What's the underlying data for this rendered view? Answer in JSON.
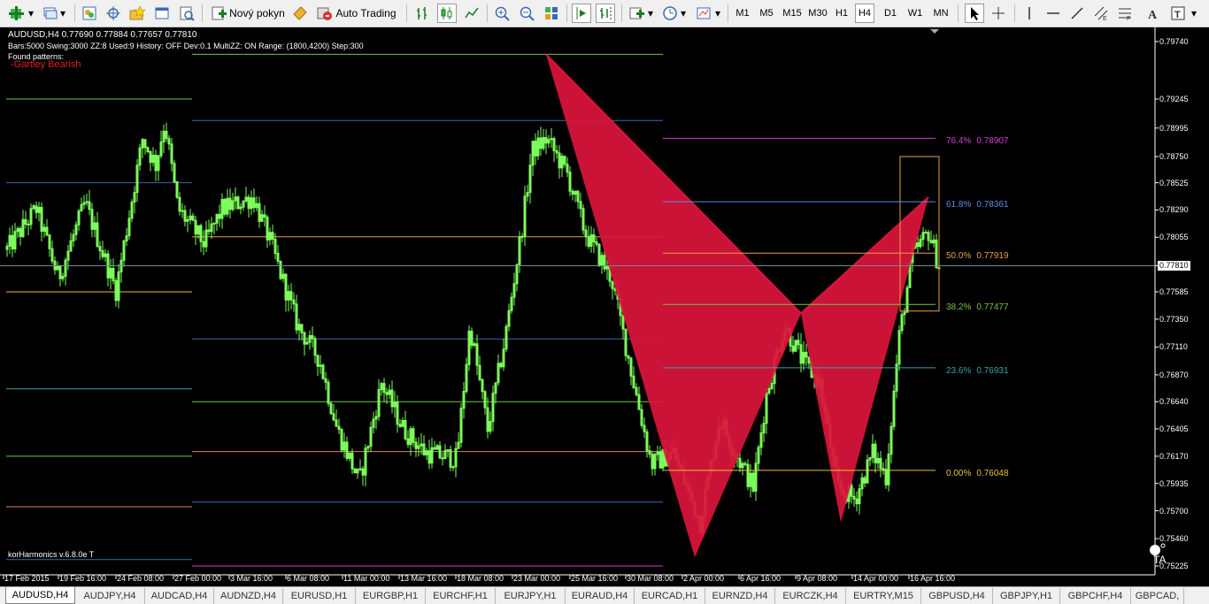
{
  "toolbar": {
    "new_order_label": "Nový pokyn",
    "auto_trading_label": "Auto Trading",
    "timeframes": [
      "M1",
      "M5",
      "M15",
      "M30",
      "H1",
      "H4",
      "D1",
      "W1",
      "MN"
    ],
    "active_timeframe": "H4"
  },
  "chart": {
    "header": "AUDUSD,H4  0.77690 0.77884 0.77657 0.77810",
    "info_line": "Bars:5000  Swing:3000  ZZ:8  Used:9  History: OFF Dev:0.1  MultiZZ: ON  Range: (1800,4200)  Step:300",
    "found_patterns_label": "Found patterns:",
    "pattern_name": "-Gartley Bearish",
    "indicator_version": "korHarmonics  v.6.8.0e T",
    "current_price": "0.77810",
    "price_axis": [
      "0.79740",
      "0.79245",
      "0.78995",
      "0.78750",
      "0.78525",
      "0.78290",
      "0.78055",
      "0.77810",
      "0.77585",
      "0.77350",
      "0.77110",
      "0.76870",
      "0.76640",
      "0.76405",
      "0.76170",
      "0.75935",
      "0.75700",
      "0.75460",
      "0.75225"
    ],
    "time_axis": [
      "17 Feb 2015",
      "19 Feb 16:00",
      "24 Feb 08:00",
      "27 Feb 00:00",
      "3 Mar 16:00",
      "6 Mar 08:00",
      "11 Mar 00:00",
      "13 Mar 16:00",
      "18 Mar 08:00",
      "23 Mar 00:00",
      "25 Mar 16:00",
      "30 Mar 08:00",
      "2 Apr 00:00",
      "6 Apr 16:00",
      "9 Apr 08:00",
      "14 Apr 00:00",
      "16 Apr 16:00"
    ],
    "fib_levels": [
      {
        "pct": "76.4%",
        "value": "0.78907",
        "color": "#d040d0"
      },
      {
        "pct": "61.8%",
        "value": "0.78361",
        "color": "#5a8ee6"
      },
      {
        "pct": "50.0%",
        "value": "0.77919",
        "color": "#e8a040"
      },
      {
        "pct": "38.2%",
        "value": "0.77477",
        "color": "#70c840"
      },
      {
        "pct": "23.6%",
        "value": "0.76931",
        "color": "#3aa0b0"
      },
      {
        "pct": "0.00%",
        "value": "0.76048",
        "color": "#e8c040"
      }
    ],
    "colors": {
      "background": "#000000",
      "candle": "#7cfc5a",
      "pattern_fill": "#dc143c",
      "grid_text": "#ffffff"
    }
  },
  "tabs": [
    "AUDUSD,H4",
    "AUDJPY,H4",
    "AUDCAD,H4",
    "AUDNZD,H4",
    "EURUSD,H1",
    "EURGBP,H1",
    "EURCHF,H1",
    "EURJPY,H1",
    "EURAUD,H4",
    "EURCAD,H1",
    "EURNZD,H4",
    "EURCZK,H4",
    "EURTRY,M15",
    "GBPUSD,H4",
    "GBPJPY,H1",
    "GBPCHF,H4",
    "GBPCAD,"
  ],
  "active_tab": "AUDUSD,H4"
}
